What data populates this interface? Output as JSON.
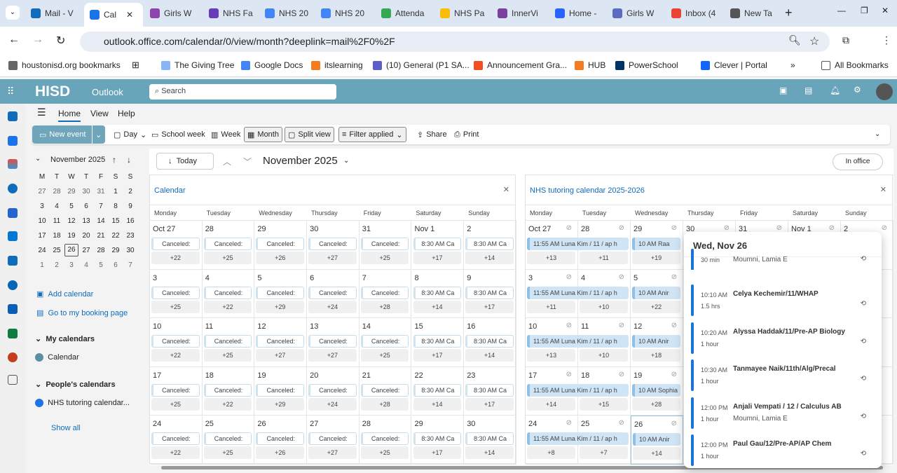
{
  "browser": {
    "tabs": [
      {
        "label": "Mail - V",
        "color": "#0f6cbd"
      },
      {
        "label": "Cal",
        "color": "#1a73e8",
        "active": true
      },
      {
        "label": "Girls W",
        "color": "#8e44ad"
      },
      {
        "label": "NHS Fa",
        "color": "#673ab7"
      },
      {
        "label": "NHS 20",
        "color": "#4285f4"
      },
      {
        "label": "NHS 20",
        "color": "#4285f4"
      },
      {
        "label": "Attenda",
        "color": "#34a853"
      },
      {
        "label": "NHS Pa",
        "color": "#fbbc04"
      },
      {
        "label": "InnerVi",
        "color": "#7b3fa0"
      },
      {
        "label": "Home -",
        "color": "#2962ff"
      },
      {
        "label": "Girls W",
        "color": "#5c6bc0"
      },
      {
        "label": "Inbox (4",
        "color": "#ea4335"
      },
      {
        "label": "New Ta",
        "color": "#555"
      }
    ],
    "url": "outlook.office.com/calendar/0/view/month?deeplink=mail%2F0%2F",
    "bookmarks": [
      {
        "label": "houstonisd.org bookmarks",
        "color": "#666"
      },
      {
        "label": "The Giving Tree",
        "color": "#8ab4f8"
      },
      {
        "label": "Google Docs",
        "color": "#4285f4"
      },
      {
        "label": "itslearning",
        "color": "#f47b20"
      },
      {
        "label": "(10) General (P1 SA...",
        "color": "#5b5fc7"
      },
      {
        "label": "Announcement Gra...",
        "color": "#f25022"
      },
      {
        "label": "HUB",
        "color": "#f47b20"
      },
      {
        "label": "PowerSchool",
        "color": "#003366"
      },
      {
        "label": "Clever | Portal",
        "color": "#1464ff"
      }
    ],
    "all_bookmarks": "All Bookmarks"
  },
  "header": {
    "brand": "HISD",
    "app": "Outlook",
    "search_placeholder": "Search"
  },
  "ribbon": {
    "tabs": [
      "Home",
      "View",
      "Help"
    ],
    "new_event": "New event",
    "day": "Day",
    "school_week": "School week",
    "week": "Week",
    "month": "Month",
    "split_view": "Split view",
    "filter": "Filter applied",
    "share": "Share",
    "print": "Print"
  },
  "mini_calendar": {
    "title": "November 2025",
    "weekdays": [
      "M",
      "T",
      "W",
      "T",
      "F",
      "S",
      "S"
    ],
    "days": [
      [
        27,
        28,
        29,
        30,
        31,
        1,
        2
      ],
      [
        3,
        4,
        5,
        6,
        7,
        8,
        9
      ],
      [
        10,
        11,
        12,
        13,
        14,
        15,
        16
      ],
      [
        17,
        18,
        19,
        20,
        21,
        22,
        23
      ],
      [
        24,
        25,
        26,
        27,
        28,
        29,
        30
      ],
      [
        1,
        2,
        3,
        4,
        5,
        6,
        7
      ]
    ],
    "today": 26
  },
  "left_pane": {
    "add_calendar": "Add calendar",
    "booking": "Go to my booking page",
    "my_calendars": "My calendars",
    "calendar": "Calendar",
    "peoples": "People's calendars",
    "nhs": "NHS tutoring calendar...",
    "show_all": "Show all"
  },
  "main": {
    "today": "Today",
    "month_title": "November 2025",
    "in_office": "In office"
  },
  "weekdays": [
    "Monday",
    "Tuesday",
    "Wednesday",
    "Thursday",
    "Friday",
    "Saturday",
    "Sunday"
  ],
  "calendar_left": {
    "title": "Calendar",
    "dates": [
      [
        "Oct 27",
        "28",
        "29",
        "30",
        "31",
        "Nov 1",
        "2"
      ],
      [
        "3",
        "4",
        "5",
        "6",
        "7",
        "8",
        "9"
      ],
      [
        "10",
        "11",
        "12",
        "13",
        "14",
        "15",
        "16"
      ],
      [
        "17",
        "18",
        "19",
        "20",
        "21",
        "22",
        "23"
      ],
      [
        "24",
        "25",
        "26",
        "27",
        "28",
        "29",
        "30"
      ]
    ],
    "events": [
      "Canceled:",
      "Canceled:",
      "Canceled:",
      "Canceled:",
      "Canceled:",
      "8:30 AM Ca",
      "8:30 AM Ca"
    ],
    "more": [
      [
        "+22",
        "+25",
        "+26",
        "+27",
        "+25",
        "+17",
        "+14"
      ],
      [
        "+25",
        "+22",
        "+29",
        "+24",
        "+28",
        "+14",
        "+17"
      ],
      [
        "+22",
        "+25",
        "+27",
        "+27",
        "+25",
        "+17",
        "+14"
      ],
      [
        "+25",
        "+22",
        "+29",
        "+24",
        "+28",
        "+14",
        "+17"
      ],
      [
        "+22",
        "+25",
        "+26",
        "+27",
        "+25",
        "+17",
        "+14"
      ]
    ]
  },
  "calendar_right": {
    "title": "NHS tutoring calendar 2025-2026",
    "dates": [
      [
        "Oct 27",
        "28",
        "29",
        "30",
        "31",
        "Nov 1",
        "2"
      ],
      [
        "3",
        "4",
        "5"
      ],
      [
        "10",
        "11",
        "12"
      ],
      [
        "17",
        "18",
        "19"
      ],
      [
        "24",
        "25",
        "26"
      ]
    ],
    "span_event": "11:55 AM Luna Kim / 11 / ap h",
    "wed_events": [
      "10 AM Raa",
      "10 AM Anir",
      "10 AM Anir",
      "10 AM Sophia",
      "10 AM Anir"
    ],
    "more": [
      [
        "+13",
        "+11",
        "+19"
      ],
      [
        "+11",
        "+10",
        "+22"
      ],
      [
        "+13",
        "+10",
        "+18"
      ],
      [
        "+14",
        "+15",
        "+28"
      ],
      [
        "+8",
        "+7",
        "+14"
      ]
    ]
  },
  "popup": {
    "title": "Wed, Nov 26",
    "events": [
      {
        "time": "",
        "dur": "30 min",
        "subject": "",
        "org": "Moumni, Lamia E"
      },
      {
        "time": "10:10 AM",
        "dur": "1.5 hrs",
        "subject": "Celya Kechemir/11/WHAP",
        "org": ""
      },
      {
        "time": "10:20 AM",
        "dur": "1 hour",
        "subject": "Alyssa Haddak/11/Pre-AP Biology",
        "org": ""
      },
      {
        "time": "10:30 AM",
        "dur": "1 hour",
        "subject": "Tanmayee Naik/11th/Alg/Precal",
        "org": ""
      },
      {
        "time": "12:00 PM",
        "dur": "1 hour",
        "subject": "Anjali Vempati / 12 / Calculus AB",
        "org": "Moumni, Lamia E"
      },
      {
        "time": "12:00 PM",
        "dur": "1 hour",
        "subject": "Paul Gau/12/Pre-AP/AP Chem",
        "org": ""
      }
    ]
  }
}
